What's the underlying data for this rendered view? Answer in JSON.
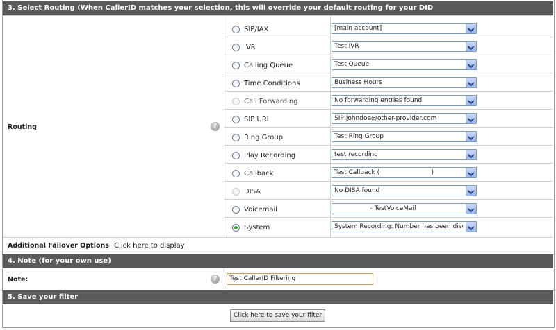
{
  "section3": {
    "title": "3. Select Routing (When CallerID matches your selection, this will override your default routing for your DID"
  },
  "routing": {
    "label": "Routing",
    "help": "?",
    "options": [
      {
        "label": "SIP/IAX",
        "value": "[main account]",
        "enabled": true,
        "checked": false
      },
      {
        "label": "IVR",
        "value": "Test IVR",
        "enabled": true,
        "checked": false
      },
      {
        "label": "Calling Queue",
        "value": "Test Queue",
        "enabled": true,
        "checked": false
      },
      {
        "label": "Time Conditions",
        "value": "Business Hours",
        "enabled": true,
        "checked": false
      },
      {
        "label": "Call Forwarding",
        "value": "No forwarding entries found",
        "enabled": false,
        "checked": false
      },
      {
        "label": "SIP URI",
        "value": "SIP:johndoe@other-provider.com",
        "enabled": true,
        "checked": false
      },
      {
        "label": "Ring Group",
        "value": "Test Ring Group",
        "enabled": true,
        "checked": false
      },
      {
        "label": "Play Recording",
        "value": "test recording",
        "enabled": true,
        "checked": false
      },
      {
        "label": "Callback",
        "value": "Test Callback (                          )",
        "enabled": true,
        "checked": false
      },
      {
        "label": "DISA",
        "value": "No DISA found",
        "enabled": false,
        "checked": false
      },
      {
        "label": "Voicemail",
        "value": "                  - TestVoiceMail",
        "enabled": true,
        "checked": false
      },
      {
        "label": "System",
        "value": "System Recording: Number has been disconn",
        "enabled": true,
        "checked": true
      }
    ]
  },
  "failover": {
    "label": "Additional Failover Options",
    "link": "Click here to display"
  },
  "section4": {
    "title": "4. Note (for your own use)"
  },
  "note": {
    "label": "Note:",
    "help": "?",
    "value": "Test CallerID Filtering"
  },
  "section5": {
    "title": "5. Save your filter"
  },
  "save": {
    "label": "Click here to save your filter"
  }
}
